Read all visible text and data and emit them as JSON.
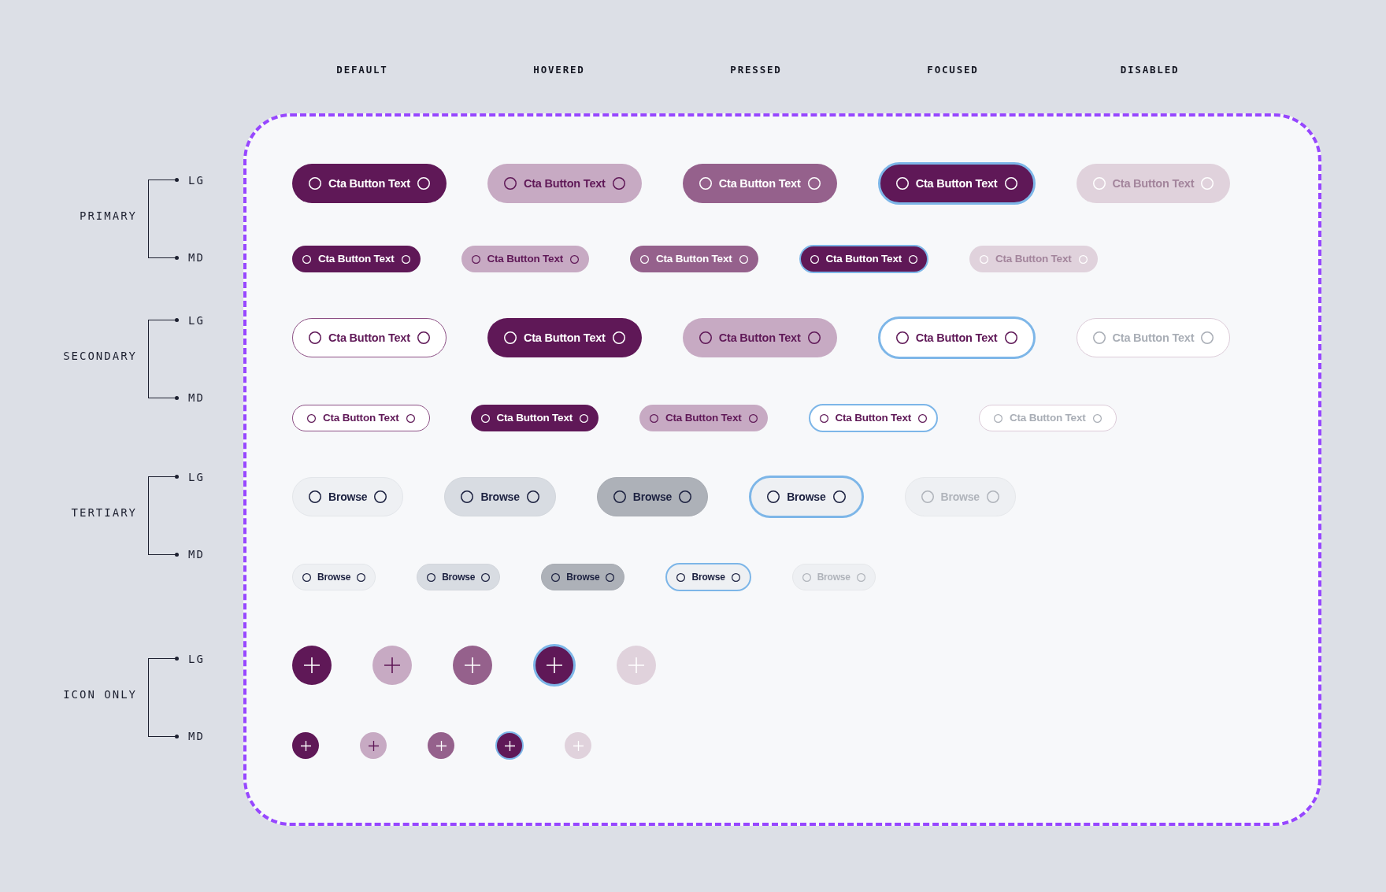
{
  "state_headers": [
    "DEFAULT",
    "HOVERED",
    "PRESSED",
    "FOCUSED",
    "DISABLED"
  ],
  "groups": [
    {
      "label": "PRIMARY",
      "kind": "primary",
      "rows": [
        {
          "size_label": "LG",
          "kind": "lg",
          "buttons": [
            {
              "text": "Cta Button Text",
              "hovered": false,
              "pressed": false,
              "focused": false,
              "disabled": false
            },
            {
              "text": "Cta Button Text",
              "hovered": true,
              "pressed": false,
              "focused": false,
              "disabled": false
            },
            {
              "text": "Cta Button Text",
              "hovered": false,
              "pressed": true,
              "focused": false,
              "disabled": false
            },
            {
              "text": "Cta Button Text",
              "hovered": false,
              "pressed": false,
              "focused": true,
              "disabled": false
            },
            {
              "text": "Cta Button Text",
              "hovered": false,
              "pressed": false,
              "focused": false,
              "disabled": true
            }
          ]
        },
        {
          "size_label": "MD",
          "kind": "md",
          "buttons": [
            {
              "text": "Cta Button Text",
              "hovered": false,
              "pressed": false,
              "focused": false,
              "disabled": false
            },
            {
              "text": "Cta Button Text",
              "hovered": true,
              "pressed": false,
              "focused": false,
              "disabled": false
            },
            {
              "text": "Cta Button Text",
              "hovered": false,
              "pressed": true,
              "focused": false,
              "disabled": false
            },
            {
              "text": "Cta Button Text",
              "hovered": false,
              "pressed": false,
              "focused": true,
              "disabled": false
            },
            {
              "text": "Cta Button Text",
              "hovered": false,
              "pressed": false,
              "focused": false,
              "disabled": true
            }
          ]
        }
      ]
    },
    {
      "label": "SECONDARY",
      "kind": "secondary",
      "rows": [
        {
          "size_label": "LG",
          "kind": "lg",
          "buttons": [
            {
              "text": "Cta Button Text",
              "hovered": false,
              "pressed": false,
              "focused": false,
              "disabled": false
            },
            {
              "text": "Cta Button Text",
              "hovered": true,
              "pressed": false,
              "focused": false,
              "disabled": false
            },
            {
              "text": "Cta Button Text",
              "hovered": false,
              "pressed": true,
              "focused": false,
              "disabled": false
            },
            {
              "text": "Cta Button Text",
              "hovered": false,
              "pressed": false,
              "focused": true,
              "disabled": false
            },
            {
              "text": "Cta Button Text",
              "hovered": false,
              "pressed": false,
              "focused": false,
              "disabled": true
            }
          ]
        },
        {
          "size_label": "MD",
          "kind": "md",
          "buttons": [
            {
              "text": "Cta Button Text",
              "hovered": false,
              "pressed": false,
              "focused": false,
              "disabled": false
            },
            {
              "text": "Cta Button Text",
              "hovered": true,
              "pressed": false,
              "focused": false,
              "disabled": false
            },
            {
              "text": "Cta Button Text",
              "hovered": false,
              "pressed": true,
              "focused": false,
              "disabled": false
            },
            {
              "text": "Cta Button Text",
              "hovered": false,
              "pressed": false,
              "focused": true,
              "disabled": false
            },
            {
              "text": "Cta Button Text",
              "hovered": false,
              "pressed": false,
              "focused": false,
              "disabled": true
            }
          ]
        }
      ]
    },
    {
      "label": "TERTIARY",
      "kind": "tertiary",
      "rows": [
        {
          "size_label": "LG",
          "kind": "lg",
          "buttons": [
            {
              "text": "Browse",
              "hovered": false,
              "pressed": false,
              "focused": false,
              "disabled": false
            },
            {
              "text": "Browse",
              "hovered": true,
              "pressed": false,
              "focused": false,
              "disabled": false
            },
            {
              "text": "Browse",
              "hovered": false,
              "pressed": true,
              "focused": false,
              "disabled": false
            },
            {
              "text": "Browse",
              "hovered": false,
              "pressed": false,
              "focused": true,
              "disabled": false
            },
            {
              "text": "Browse",
              "hovered": false,
              "pressed": false,
              "focused": false,
              "disabled": true
            }
          ]
        },
        {
          "size_label": "MD",
          "kind": "md",
          "buttons": [
            {
              "text": "Browse",
              "hovered": false,
              "pressed": false,
              "focused": false,
              "disabled": false
            },
            {
              "text": "Browse",
              "hovered": true,
              "pressed": false,
              "focused": false,
              "disabled": false
            },
            {
              "text": "Browse",
              "hovered": false,
              "pressed": true,
              "focused": false,
              "disabled": false
            },
            {
              "text": "Browse",
              "hovered": false,
              "pressed": false,
              "focused": true,
              "disabled": false
            },
            {
              "text": "Browse",
              "hovered": false,
              "pressed": false,
              "focused": false,
              "disabled": true
            }
          ]
        }
      ]
    },
    {
      "label": "ICON ONLY",
      "kind": "icon",
      "rows": [
        {
          "size_label": "LG",
          "kind": "lg",
          "buttons": [
            {
              "hovered": false,
              "pressed": false,
              "focused": false,
              "disabled": false
            },
            {
              "hovered": true,
              "pressed": false,
              "focused": false,
              "disabled": false
            },
            {
              "hovered": false,
              "pressed": true,
              "focused": false,
              "disabled": false
            },
            {
              "hovered": false,
              "pressed": false,
              "focused": true,
              "disabled": false
            },
            {
              "hovered": false,
              "pressed": false,
              "focused": false,
              "disabled": true
            }
          ]
        },
        {
          "size_label": "MD",
          "kind": "md",
          "buttons": [
            {
              "hovered": false,
              "pressed": false,
              "focused": false,
              "disabled": false
            },
            {
              "hovered": true,
              "pressed": false,
              "focused": false,
              "disabled": false
            },
            {
              "hovered": false,
              "pressed": true,
              "focused": false,
              "disabled": false
            },
            {
              "hovered": false,
              "pressed": false,
              "focused": true,
              "disabled": false
            },
            {
              "hovered": false,
              "pressed": false,
              "focused": false,
              "disabled": true
            }
          ]
        }
      ]
    }
  ]
}
